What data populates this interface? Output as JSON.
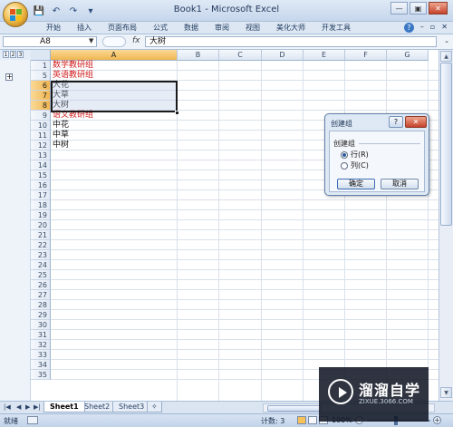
{
  "window": {
    "title": "Book1 - Microsoft Excel",
    "buttons": {
      "minimize": "—",
      "restore": "▣",
      "close": "✕"
    }
  },
  "qat": [
    "💾",
    "↶",
    "↷",
    "▾"
  ],
  "ribbon": {
    "tabs": [
      "开始",
      "插入",
      "页面布局",
      "公式",
      "数据",
      "审阅",
      "视图",
      "美化大师",
      "开发工具"
    ],
    "help": "?",
    "right_controls": [
      "–",
      "▫",
      "✕"
    ]
  },
  "formula_bar": {
    "name_box": "A8",
    "fx": "fx",
    "value": "大树"
  },
  "outline": {
    "levels": [
      "1",
      "2",
      "3"
    ],
    "expand_symbol": "+"
  },
  "columns": [
    "A",
    "B",
    "C",
    "D",
    "E",
    "F",
    "G"
  ],
  "rows": [
    {
      "num": "1",
      "value": "数学教研组",
      "red": true
    },
    {
      "num": "5",
      "value": "英语教研组",
      "red": true
    },
    {
      "num": "6",
      "value": "大花",
      "red": false
    },
    {
      "num": "7",
      "value": "大草",
      "red": false
    },
    {
      "num": "8",
      "value": "大树",
      "red": false
    },
    {
      "num": "9",
      "value": "语文教研组",
      "red": true
    },
    {
      "num": "10",
      "value": "中花",
      "red": false
    },
    {
      "num": "11",
      "value": "中草",
      "red": false
    },
    {
      "num": "12",
      "value": "中树",
      "red": false
    },
    {
      "num": "13",
      "value": ""
    },
    {
      "num": "14",
      "value": ""
    },
    {
      "num": "15",
      "value": ""
    },
    {
      "num": "16",
      "value": ""
    },
    {
      "num": "17",
      "value": ""
    },
    {
      "num": "18",
      "value": ""
    },
    {
      "num": "19",
      "value": ""
    },
    {
      "num": "20",
      "value": ""
    },
    {
      "num": "21",
      "value": ""
    },
    {
      "num": "22",
      "value": ""
    },
    {
      "num": "23",
      "value": ""
    },
    {
      "num": "24",
      "value": ""
    },
    {
      "num": "25",
      "value": ""
    },
    {
      "num": "26",
      "value": ""
    },
    {
      "num": "27",
      "value": ""
    },
    {
      "num": "28",
      "value": ""
    },
    {
      "num": "29",
      "value": ""
    },
    {
      "num": "30",
      "value": ""
    },
    {
      "num": "31",
      "value": ""
    },
    {
      "num": "32",
      "value": ""
    },
    {
      "num": "33",
      "value": ""
    },
    {
      "num": "34",
      "value": ""
    },
    {
      "num": "35",
      "value": ""
    }
  ],
  "selected_rows": [
    "6",
    "7",
    "8"
  ],
  "sheets": [
    "Sheet1",
    "Sheet2",
    "Sheet3"
  ],
  "active_sheet": "Sheet1",
  "sheet_nav": [
    "|◀",
    "◀",
    "▶",
    "▶|"
  ],
  "status": {
    "ready": "就绪",
    "count": "计数: 3",
    "zoom": "100%",
    "zoom_out": "-",
    "zoom_in": "+"
  },
  "dialog": {
    "title": "创建组",
    "help": "?",
    "close": "✕",
    "group_label": "创建组",
    "options": [
      {
        "label": "行(R)",
        "selected": true
      },
      {
        "label": "列(C)",
        "selected": false
      }
    ],
    "ok": "确定",
    "cancel": "取消"
  },
  "watermark": {
    "name": "溜溜自学",
    "url": "ZIXUE.3066.COM"
  },
  "colors": {
    "red_text": "#d21d1d",
    "selection_header": "#f1b64f"
  }
}
